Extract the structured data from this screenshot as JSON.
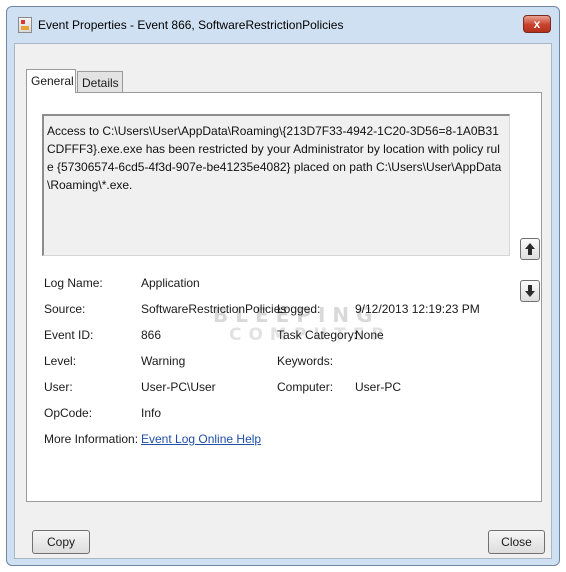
{
  "window": {
    "title": "Event Properties - Event 866, SoftwareRestrictionPolicies",
    "close_glyph": "x"
  },
  "tabs": [
    {
      "label": "General"
    },
    {
      "label": "Details"
    }
  ],
  "message": "Access to C:\\Users\\User\\AppData\\Roaming\\{213D7F33-4942-1C20-3D56=8-1A0B31CDFFF3}.exe.exe has been restricted by your Administrator by location with policy rule {57306574-6cd5-4f3d-907e-be41235e4082} placed on path C:\\Users\\User\\AppData\\Roaming\\*.exe.",
  "watermark": {
    "line1": "BLEEPING",
    "line2": "COMPUTER"
  },
  "fields": {
    "log_name": {
      "label": "Log Name:",
      "value": "Application"
    },
    "source": {
      "label": "Source:",
      "value": "SoftwareRestrictionPolicies"
    },
    "logged": {
      "label": "Logged:",
      "value": "9/12/2013 12:19:23 PM"
    },
    "event_id": {
      "label": "Event ID:",
      "value": "866"
    },
    "task_category": {
      "label": "Task Category:",
      "value": "None"
    },
    "level": {
      "label": "Level:",
      "value": "Warning"
    },
    "keywords": {
      "label": "Keywords:",
      "value": ""
    },
    "user": {
      "label": "User:",
      "value": "User-PC\\User"
    },
    "computer": {
      "label": "Computer:",
      "value": "User-PC"
    },
    "opcode": {
      "label": "OpCode:",
      "value": "Info"
    },
    "more_info": {
      "label": "More Information:",
      "value": "Event Log Online Help"
    }
  },
  "buttons": {
    "copy": "Copy",
    "close": "Close"
  },
  "icons": {
    "app": "event-viewer-icon",
    "up": "arrow-up-icon",
    "down": "arrow-down-icon"
  },
  "colors": {
    "link": "#1f4fa8",
    "close_button": "#c8412c",
    "frame": "#cfe0f3"
  }
}
